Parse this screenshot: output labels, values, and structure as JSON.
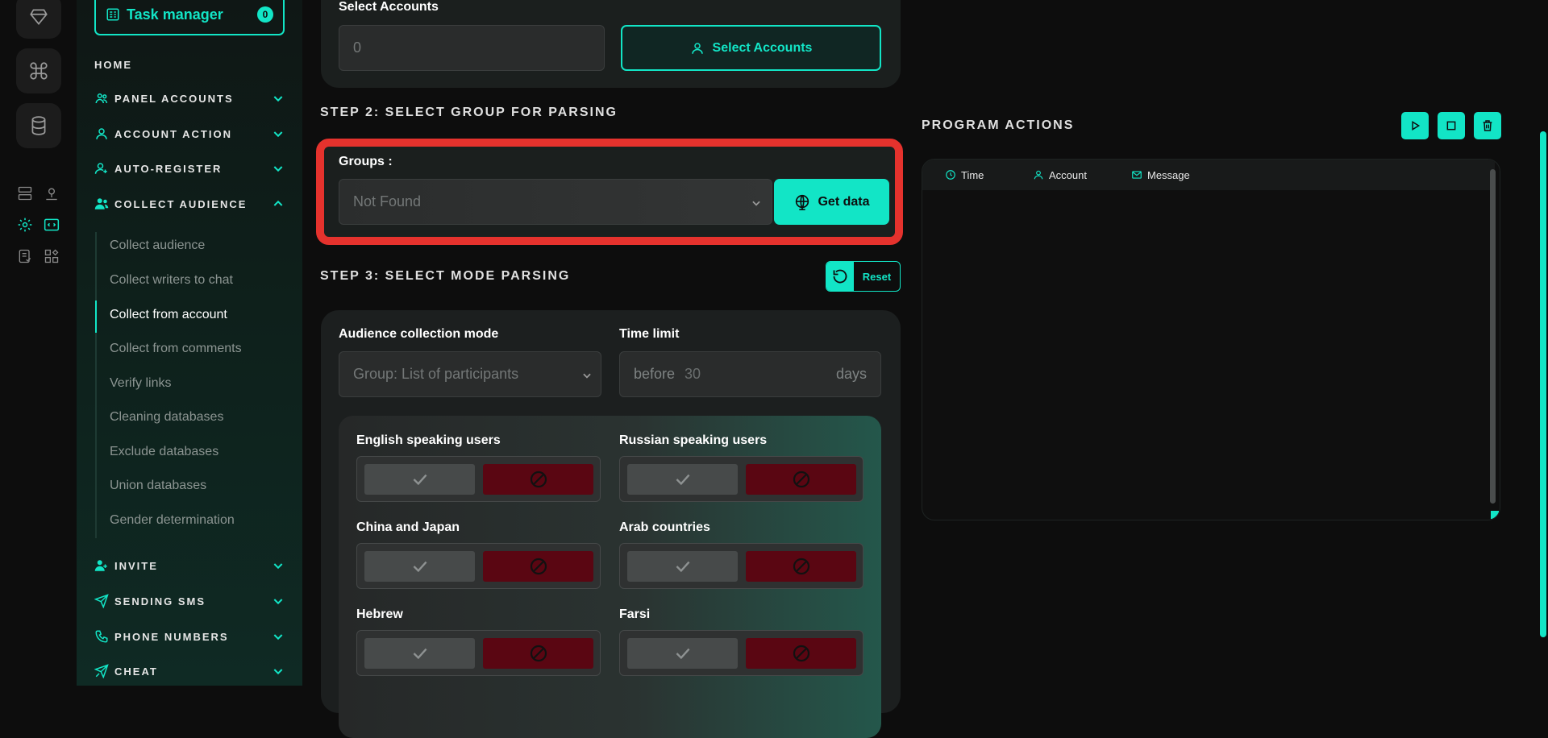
{
  "sidebar": {
    "task_manager": {
      "label": "Task manager",
      "count": "0"
    },
    "home": "HOME",
    "sections": [
      {
        "label": "PANEL ACCOUNTS",
        "icon": "users-icon"
      },
      {
        "label": "ACCOUNT ACTION",
        "icon": "user-icon"
      },
      {
        "label": "AUTO-REGISTER",
        "icon": "user-plus-icon"
      },
      {
        "label": "COLLECT AUDIENCE",
        "icon": "users-filled-icon"
      }
    ],
    "collect_items": [
      "Collect audience",
      "Collect writers to chat",
      "Collect from account",
      "Collect from comments",
      "Verify links",
      "Cleaning databases",
      "Exclude databases",
      "Union databases",
      "Gender determination"
    ],
    "active_item": "Collect from account",
    "bottom_sections": [
      {
        "label": "INVITE",
        "icon": "user-plus-filled-icon"
      },
      {
        "label": "SENDING SMS",
        "icon": "send-icon"
      },
      {
        "label": "PHONE NUMBERS",
        "icon": "phone-icon"
      },
      {
        "label": "CHEAT",
        "icon": "cheat-icon"
      }
    ]
  },
  "step1": {
    "title": "Select Accounts",
    "count_value": "0",
    "button": "Select Accounts"
  },
  "step2": {
    "title": "STEP 2: SELECT GROUP FOR PARSING",
    "groups_label": "Groups :",
    "groups_value": "Not Found",
    "get_data": "Get data"
  },
  "step3": {
    "title": "STEP 3: SELECT MODE PARSING",
    "reset": "Reset",
    "mode_label": "Audience collection mode",
    "mode_value": "Group: List of participants",
    "time_label": "Time limit",
    "time_prefix": "before",
    "time_value": "30",
    "time_suffix": "days",
    "languages": [
      "English speaking users",
      "Russian speaking users",
      "China and Japan",
      "Arab countries",
      "Hebrew",
      "Farsi"
    ]
  },
  "program_actions": {
    "title": "PROGRAM ACTIONS",
    "columns": [
      "Time",
      "Account",
      "Message"
    ]
  },
  "colors": {
    "accent": "#12e5c6",
    "danger": "#e5322d",
    "block": "#5a0612",
    "background": "#0d0d0d"
  }
}
